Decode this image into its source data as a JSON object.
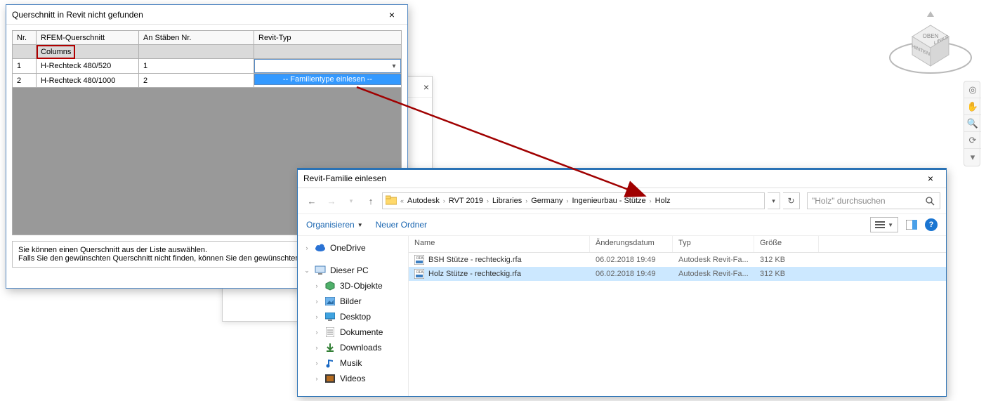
{
  "dialog1": {
    "title": "Querschnitt in Revit nicht gefunden",
    "headers": {
      "nr": "Nr.",
      "q": " RFEM-Querschnitt",
      "stab": "An Stäben Nr.",
      "revit": "Revit-Typ"
    },
    "group_label": "Columns",
    "rows": [
      {
        "nr": "1",
        "q": "H-Rechteck 480/520",
        "stab": "1",
        "revit_open": true
      },
      {
        "nr": "2",
        "q": "H-Rechteck 480/1000",
        "stab": "2",
        "revit_open": false
      }
    ],
    "dropdown_option": "-- Familientype einlesen --",
    "footer": "Sie können einen Querschnitt aus der Liste auswählen.\nFalls Sie den gewünschten Querschnitt nicht finden, können Sie den gewünschten Typ einlesen."
  },
  "dialog2": {
    "title": "Revit-Familie einlesen",
    "breadcrumb": [
      "Autodesk",
      "RVT 2019",
      "Libraries",
      "Germany",
      "Ingenieurbau - Stütze",
      "Holz"
    ],
    "search_placeholder": "\"Holz\" durchsuchen",
    "toolbar": {
      "organize": "Organisieren",
      "new_folder": "Neuer Ordner"
    },
    "columns": {
      "name": "Name",
      "date": "Änderungsdatum",
      "type": "Typ",
      "size": "Größe"
    },
    "tree": [
      {
        "icon": "cloud",
        "label": "OneDrive",
        "caret": ">"
      },
      {
        "icon": "pc",
        "label": "Dieser PC",
        "caret": "v",
        "children": [
          {
            "icon": "cube",
            "label": "3D-Objekte"
          },
          {
            "icon": "pics",
            "label": "Bilder"
          },
          {
            "icon": "desk",
            "label": "Desktop"
          },
          {
            "icon": "docs",
            "label": "Dokumente"
          },
          {
            "icon": "dl",
            "label": "Downloads"
          },
          {
            "icon": "music",
            "label": "Musik"
          },
          {
            "icon": "vid",
            "label": "Videos"
          }
        ]
      }
    ],
    "files": [
      {
        "name": "BSH Stütze - rechteckig.rfa",
        "date": "06.02.2018 19:49",
        "type": "Autodesk Revit-Fa...",
        "size": "312 KB",
        "selected": false
      },
      {
        "name": "Holz Stütze - rechteckig.rfa",
        "date": "06.02.2018 19:49",
        "type": "Autodesk Revit-Fa...",
        "size": "312 KB",
        "selected": true
      }
    ]
  },
  "viewcube": {
    "top": "OBEN",
    "back": "HINTEN",
    "right": "LINKS"
  }
}
